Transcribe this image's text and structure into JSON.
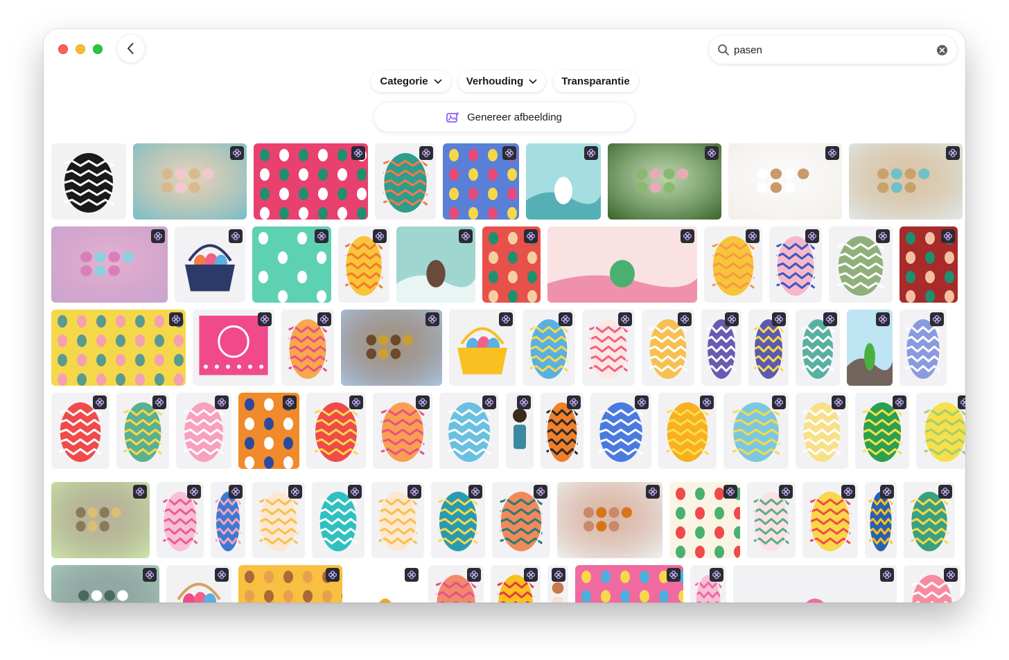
{
  "window": {
    "back_label": ""
  },
  "search": {
    "value": "pasen",
    "placeholder": ""
  },
  "filters": {
    "category_label": "Categorie",
    "ratio_label": "Verhouding",
    "transparency_label": "Transparantie"
  },
  "generate": {
    "label": "Genereer afbeelding"
  },
  "icons": {
    "back": "chevron-left-icon",
    "search": "magnifier-icon",
    "clear": "clear-circle-icon",
    "dropdown": "chevron-down-icon",
    "generate": "image-sparkle-icon",
    "badge": "ai-flower-badge-icon"
  },
  "colors": {
    "accent": "#8b5cf6",
    "badge_bg": "#2b2b33",
    "tile_bg": "#f2f2f4"
  },
  "results": [
    {
      "kind": "egg",
      "bg": "#f2f2f4",
      "c1": "#1a1a1a",
      "c2": "#ffffff",
      "ai": false
    },
    {
      "kind": "photo",
      "bg": "#7fbfc6",
      "c1": "#f4c7d0",
      "c2": "#d9b98c",
      "ai": true
    },
    {
      "kind": "pattern",
      "bg": "#e8416f",
      "c1": "#1f8f6f",
      "c2": "#ffffff",
      "ai": true
    },
    {
      "kind": "egg",
      "bg": "#f2f2f4",
      "c1": "#2f9c8c",
      "c2": "#f47a4a",
      "ai": true
    },
    {
      "kind": "pattern",
      "bg": "#5a7fd6",
      "c1": "#f4d84a",
      "c2": "#e84a7a",
      "ai": true
    },
    {
      "kind": "scene",
      "bg": "#a6dde0",
      "c1": "#3aa0a8",
      "c2": "#ffffff",
      "ai": true
    },
    {
      "kind": "photo",
      "bg": "#3f6b34",
      "c1": "#e9aab8",
      "c2": "#8ab870",
      "ai": true
    },
    {
      "kind": "photo",
      "bg": "#f3efe9",
      "c1": "#c89a6a",
      "c2": "#ffffff",
      "ai": true
    },
    {
      "kind": "photo",
      "bg": "#dfe5e3",
      "c1": "#6fc0c8",
      "c2": "#c9a16a",
      "ai": true
    },
    {
      "kind": "photo",
      "bg": "#c9a6cf",
      "c1": "#8fd0e0",
      "c2": "#d77fb8",
      "ai": true
    },
    {
      "kind": "basket",
      "bg": "#f2f2f4",
      "c1": "#2c3a6a",
      "c2": "#f47a4a",
      "ai": true
    },
    {
      "kind": "pattern",
      "bg": "#5fd1b3",
      "c1": "#ffffff",
      "c2": "#5fd1b3",
      "ai": true
    },
    {
      "kind": "egg",
      "bg": "#f2f2f4",
      "c1": "#f8c53a",
      "c2": "#f47a2a",
      "ai": true
    },
    {
      "kind": "scene",
      "bg": "#9fd6d0",
      "c1": "#ffffff",
      "c2": "#6a4a3a",
      "ai": true
    },
    {
      "kind": "pattern",
      "bg": "#e8504a",
      "c1": "#1f8f6f",
      "c2": "#f4d0a0",
      "ai": true
    },
    {
      "kind": "scene",
      "bg": "#fbe2e2",
      "c1": "#e8759a",
      "c2": "#4ab070",
      "ai": true
    },
    {
      "kind": "egg",
      "bg": "#f2f2f4",
      "c1": "#f8c53a",
      "c2": "#f49a4a",
      "ai": true
    },
    {
      "kind": "egg",
      "bg": "#f2f2f4",
      "c1": "#f8b8cc",
      "c2": "#3a5ac0",
      "ai": true
    },
    {
      "kind": "egg",
      "bg": "#f2f2f4",
      "c1": "#8fb07a",
      "c2": "#ffffff",
      "ai": true
    },
    {
      "kind": "pattern",
      "bg": "#a82a2a",
      "c1": "#1f8f6f",
      "c2": "#f4c0a0",
      "ai": true
    },
    {
      "kind": "pattern",
      "bg": "#f4d84a",
      "c1": "#5a9a90",
      "c2": "#f4a0b0",
      "ai": true
    },
    {
      "kind": "papel",
      "bg": "#f2f2f4",
      "c1": "#f04a8a",
      "c2": "#ffffff",
      "ai": true
    },
    {
      "kind": "egg",
      "bg": "#f2f2f4",
      "c1": "#f8a84a",
      "c2": "#e8508a",
      "ai": true
    },
    {
      "kind": "photo",
      "bg": "#a9bfd9",
      "c1": "#c9a030",
      "c2": "#6a4a2a",
      "ai": true
    },
    {
      "kind": "basket",
      "bg": "#f2f2f4",
      "c1": "#f8c020",
      "c2": "#5ab0e0",
      "ai": true
    },
    {
      "kind": "egg",
      "bg": "#f2f2f4",
      "c1": "#5ab0e0",
      "c2": "#f8d84a",
      "ai": true
    },
    {
      "kind": "egg",
      "bg": "#f2f2f4",
      "c1": "#fce8e0",
      "c2": "#f0608a",
      "ai": true
    },
    {
      "kind": "egg",
      "bg": "#f2f2f4",
      "c1": "#f8c050",
      "c2": "#ffffff",
      "ai": true
    },
    {
      "kind": "egg",
      "bg": "#f2f2f4",
      "c1": "#6a5ab0",
      "c2": "#ffffff",
      "ai": true
    },
    {
      "kind": "egg",
      "bg": "#f2f2f4",
      "c1": "#5a5ab0",
      "c2": "#f8d84a",
      "ai": true
    },
    {
      "kind": "egg",
      "bg": "#f2f2f4",
      "c1": "#5ab0a0",
      "c2": "#ffffff",
      "ai": true
    },
    {
      "kind": "scene",
      "bg": "#bfe4f4",
      "c1": "#5a3a2a",
      "c2": "#4ab040",
      "ai": true
    },
    {
      "kind": "egg",
      "bg": "#f2f2f4",
      "c1": "#8a9ae0",
      "c2": "#ffffff",
      "ai": true
    },
    {
      "kind": "egg",
      "bg": "#f2f2f4",
      "c1": "#f04a4a",
      "c2": "#ffffff",
      "ai": true
    },
    {
      "kind": "egg",
      "bg": "#f2f2f4",
      "c1": "#5ab090",
      "c2": "#f8d84a",
      "ai": true
    },
    {
      "kind": "egg",
      "bg": "#f2f2f4",
      "c1": "#f8a0c0",
      "c2": "#ffffff",
      "ai": true
    },
    {
      "kind": "pattern",
      "bg": "#f08a2a",
      "c1": "#2a4aa0",
      "c2": "#ffffff",
      "ai": true
    },
    {
      "kind": "egg",
      "bg": "#f2f2f4",
      "c1": "#f04a4a",
      "c2": "#f8d84a",
      "ai": true
    },
    {
      "kind": "egg",
      "bg": "#f2f2f4",
      "c1": "#f8a050",
      "c2": "#e8508a",
      "ai": true
    },
    {
      "kind": "egg",
      "bg": "#f2f2f4",
      "c1": "#6ac0e0",
      "c2": "#ffffff",
      "ai": true
    },
    {
      "kind": "figure",
      "bg": "#f2f2f4",
      "c1": "#3a2a1a",
      "c2": "#3a8aa0",
      "ai": true
    },
    {
      "kind": "egg",
      "bg": "#f2f2f4",
      "c1": "#f0802a",
      "c2": "#2a2a2a",
      "ai": true
    },
    {
      "kind": "egg",
      "bg": "#f2f2f4",
      "c1": "#4a7ae0",
      "c2": "#ffffff",
      "ai": true
    },
    {
      "kind": "egg",
      "bg": "#f2f2f4",
      "c1": "#f8b020",
      "c2": "#f8e04a",
      "ai": true
    },
    {
      "kind": "egg",
      "bg": "#f2f2f4",
      "c1": "#7ac8e0",
      "c2": "#f8d84a",
      "ai": true
    },
    {
      "kind": "egg",
      "bg": "#f2f2f4",
      "c1": "#f8e08a",
      "c2": "#ffffff",
      "ai": true
    },
    {
      "kind": "egg",
      "bg": "#f2f2f4",
      "c1": "#2aa050",
      "c2": "#f8e04a",
      "ai": true
    },
    {
      "kind": "egg",
      "bg": "#f2f2f4",
      "c1": "#f8e04a",
      "c2": "#a0d070",
      "ai": true
    },
    {
      "kind": "photo",
      "bg": "#c8e0a8",
      "c1": "#d8c070",
      "c2": "#8a7a5a",
      "ai": true
    },
    {
      "kind": "egg",
      "bg": "#f2f2f4",
      "c1": "#f8c0d8",
      "c2": "#e8608a",
      "ai": true
    },
    {
      "kind": "egg",
      "bg": "#f2f2f4",
      "c1": "#3a7ad0",
      "c2": "#f8a0c0",
      "ai": true
    },
    {
      "kind": "egg",
      "bg": "#f2f2f4",
      "c1": "#fce8d0",
      "c2": "#f8c04a",
      "ai": true
    },
    {
      "kind": "egg",
      "bg": "#f2f2f4",
      "c1": "#30c0c0",
      "c2": "#ffffff",
      "ai": true
    },
    {
      "kind": "egg",
      "bg": "#f2f2f4",
      "c1": "#fce8d0",
      "c2": "#f8c04a",
      "ai": true
    },
    {
      "kind": "egg",
      "bg": "#f2f2f4",
      "c1": "#2a9ab0",
      "c2": "#f8d84a",
      "ai": true
    },
    {
      "kind": "egg",
      "bg": "#f2f2f4",
      "c1": "#f08a5a",
      "c2": "#2a7a7a",
      "ai": true
    },
    {
      "kind": "photo",
      "bg": "#ececec",
      "c1": "#d8741a",
      "c2": "#c88a6a",
      "ai": true
    },
    {
      "kind": "pattern",
      "bg": "#faf4e4",
      "c1": "#f04a4a",
      "c2": "#4ab070",
      "ai": true
    },
    {
      "kind": "egg",
      "bg": "#f2f2f4",
      "c1": "#fce0e8",
      "c2": "#5ab080",
      "ai": true
    },
    {
      "kind": "egg",
      "bg": "#f2f2f4",
      "c1": "#f8d84a",
      "c2": "#f04a4a",
      "ai": true
    },
    {
      "kind": "egg",
      "bg": "#f2f2f4",
      "c1": "#2a60b0",
      "c2": "#f8c020",
      "ai": true
    },
    {
      "kind": "egg",
      "bg": "#f2f2f4",
      "c1": "#3aa080",
      "c2": "#f8d84a",
      "ai": true
    },
    {
      "kind": "photo",
      "bg": "#a8c8c0",
      "c1": "#ffffff",
      "c2": "#4a6a60",
      "ai": true
    },
    {
      "kind": "basket",
      "bg": "#f2f2f4",
      "c1": "#d8a060",
      "c2": "#f04a8a",
      "ai": true
    },
    {
      "kind": "pattern",
      "bg": "#f8c040",
      "c1": "#a86a3a",
      "c2": "#e8a050",
      "ai": true
    },
    {
      "kind": "scene",
      "bg": "#ffffff",
      "c1": "#c81a1a",
      "c2": "#f8a020",
      "ai": true
    },
    {
      "kind": "egg",
      "bg": "#f2f2f4",
      "c1": "#f08a6a",
      "c2": "#e8508a",
      "ai": true
    },
    {
      "kind": "egg",
      "bg": "#f2f2f4",
      "c1": "#f8c020",
      "c2": "#e83a3a",
      "ai": true
    },
    {
      "kind": "figure",
      "bg": "#f2f2f4",
      "c1": "#c87a4a",
      "c2": "#f8e0d0",
      "ai": true
    },
    {
      "kind": "pattern",
      "bg": "#f06aa0",
      "c1": "#f8d84a",
      "c2": "#4ab0e0",
      "ai": true
    },
    {
      "kind": "egg",
      "bg": "#f2f2f4",
      "c1": "#f8c0d8",
      "c2": "#f06aa0",
      "ai": true
    },
    {
      "kind": "scene",
      "bg": "#f2f2f4",
      "c1": "#4a8af0",
      "c2": "#f06aa0",
      "ai": true
    },
    {
      "kind": "egg",
      "bg": "#f2f2f4",
      "c1": "#f88aa0",
      "c2": "#ffffff",
      "ai": true
    }
  ]
}
